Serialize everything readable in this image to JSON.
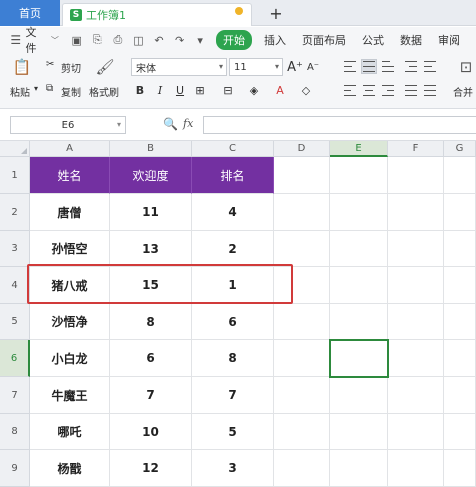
{
  "tabs": {
    "home": "首页",
    "workbook": "工作簿1",
    "add": "+"
  },
  "menu": {
    "file": "文件",
    "tabs": [
      "插入",
      "页面布局",
      "公式",
      "数据",
      "审阅"
    ],
    "active_tab": "开始"
  },
  "ribbon": {
    "paste": "粘贴",
    "cut": "剪切",
    "copy": "复制",
    "format_painter": "格式刷",
    "font_name": "宋体",
    "font_size": "11",
    "merge": "合并"
  },
  "formula_bar": {
    "cell_ref": "E6",
    "fx": "fx",
    "value": ""
  },
  "sheet": {
    "columns": [
      "A",
      "B",
      "C",
      "D",
      "E",
      "F",
      "G"
    ],
    "selected_column": "E",
    "rows": [
      "1",
      "2",
      "3",
      "4",
      "5",
      "6",
      "7",
      "8",
      "9"
    ],
    "selected_row": "6",
    "header_row": [
      "姓名",
      "欢迎度",
      "排名"
    ],
    "data": [
      [
        "唐僧",
        "11",
        "4"
      ],
      [
        "孙悟空",
        "13",
        "2"
      ],
      [
        "猪八戒",
        "15",
        "1"
      ],
      [
        "沙悟净",
        "8",
        "6"
      ],
      [
        "小白龙",
        "6",
        "8"
      ],
      [
        "牛魔王",
        "7",
        "7"
      ],
      [
        "哪吒",
        "10",
        "5"
      ],
      [
        "杨戬",
        "12",
        "3"
      ]
    ]
  },
  "colors": {
    "header_fill": "#7330a1",
    "highlight_border": "#d13a3a",
    "accent": "#2d8a3d"
  }
}
